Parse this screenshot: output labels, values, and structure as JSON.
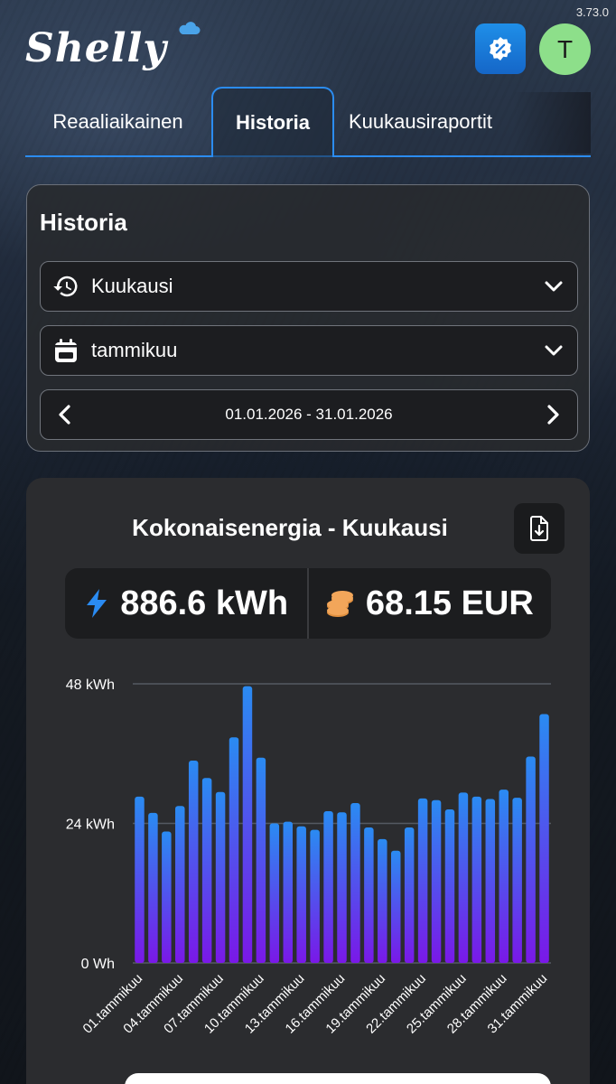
{
  "app": {
    "version": "3.73.0",
    "logo_text": "Shelly",
    "avatar_initial": "T"
  },
  "tabs": [
    {
      "label": "Reaaliaikainen"
    },
    {
      "label": "Historia"
    },
    {
      "label": "Kuukausiraportit"
    }
  ],
  "history": {
    "title": "Historia",
    "period_select": {
      "value": "Kuukausi",
      "icon": "history-icon"
    },
    "month_select": {
      "value": "tammikuu",
      "icon": "calendar-icon"
    },
    "date_range": "01.01.2026 - 31.01.2026"
  },
  "energy": {
    "title": "Kokonaisenergia - Kuukausi",
    "total_energy": "886.6 kWh",
    "total_cost": "68.15 EUR",
    "colors": {
      "bar_top": "#2a8bf2",
      "bar_bottom": "#7a18e8",
      "energy_icon": "#2a8bf2",
      "cost_icon": "#f2a65a"
    }
  },
  "chart_data": {
    "type": "bar",
    "y_unit": "kWh",
    "ylim": [
      0,
      48
    ],
    "y_ticks": [
      "0 Wh",
      "24 kWh",
      "48 kWh"
    ],
    "x_tick_labels": [
      "01.tammikuu",
      "04.tammikuu",
      "07.tammikuu",
      "10.tammikuu",
      "13.tammikuu",
      "16.tammikuu",
      "19.tammikuu",
      "22.tammikuu",
      "25.tammikuu",
      "28.tammikuu",
      "31.tammikuu"
    ],
    "categories": [
      "01.tammikuu",
      "02.tammikuu",
      "03.tammikuu",
      "04.tammikuu",
      "05.tammikuu",
      "06.tammikuu",
      "07.tammikuu",
      "08.tammikuu",
      "09.tammikuu",
      "10.tammikuu",
      "11.tammikuu",
      "12.tammikuu",
      "13.tammikuu",
      "14.tammikuu",
      "15.tammikuu",
      "16.tammikuu",
      "17.tammikuu",
      "18.tammikuu",
      "19.tammikuu",
      "20.tammikuu",
      "21.tammikuu",
      "22.tammikuu",
      "23.tammikuu",
      "24.tammikuu",
      "25.tammikuu",
      "26.tammikuu",
      "27.tammikuu",
      "28.tammikuu",
      "29.tammikuu",
      "30.tammikuu",
      "31.tammikuu"
    ],
    "values": [
      28.6,
      25.8,
      22.6,
      27.0,
      34.8,
      31.8,
      29.4,
      38.8,
      47.6,
      35.3,
      24.0,
      24.3,
      23.5,
      22.9,
      26.1,
      25.9,
      27.5,
      23.3,
      21.3,
      19.3,
      23.3,
      28.3,
      28.0,
      26.4,
      29.3,
      28.6,
      28.2,
      29.8,
      28.4,
      35.5,
      42.8
    ]
  }
}
